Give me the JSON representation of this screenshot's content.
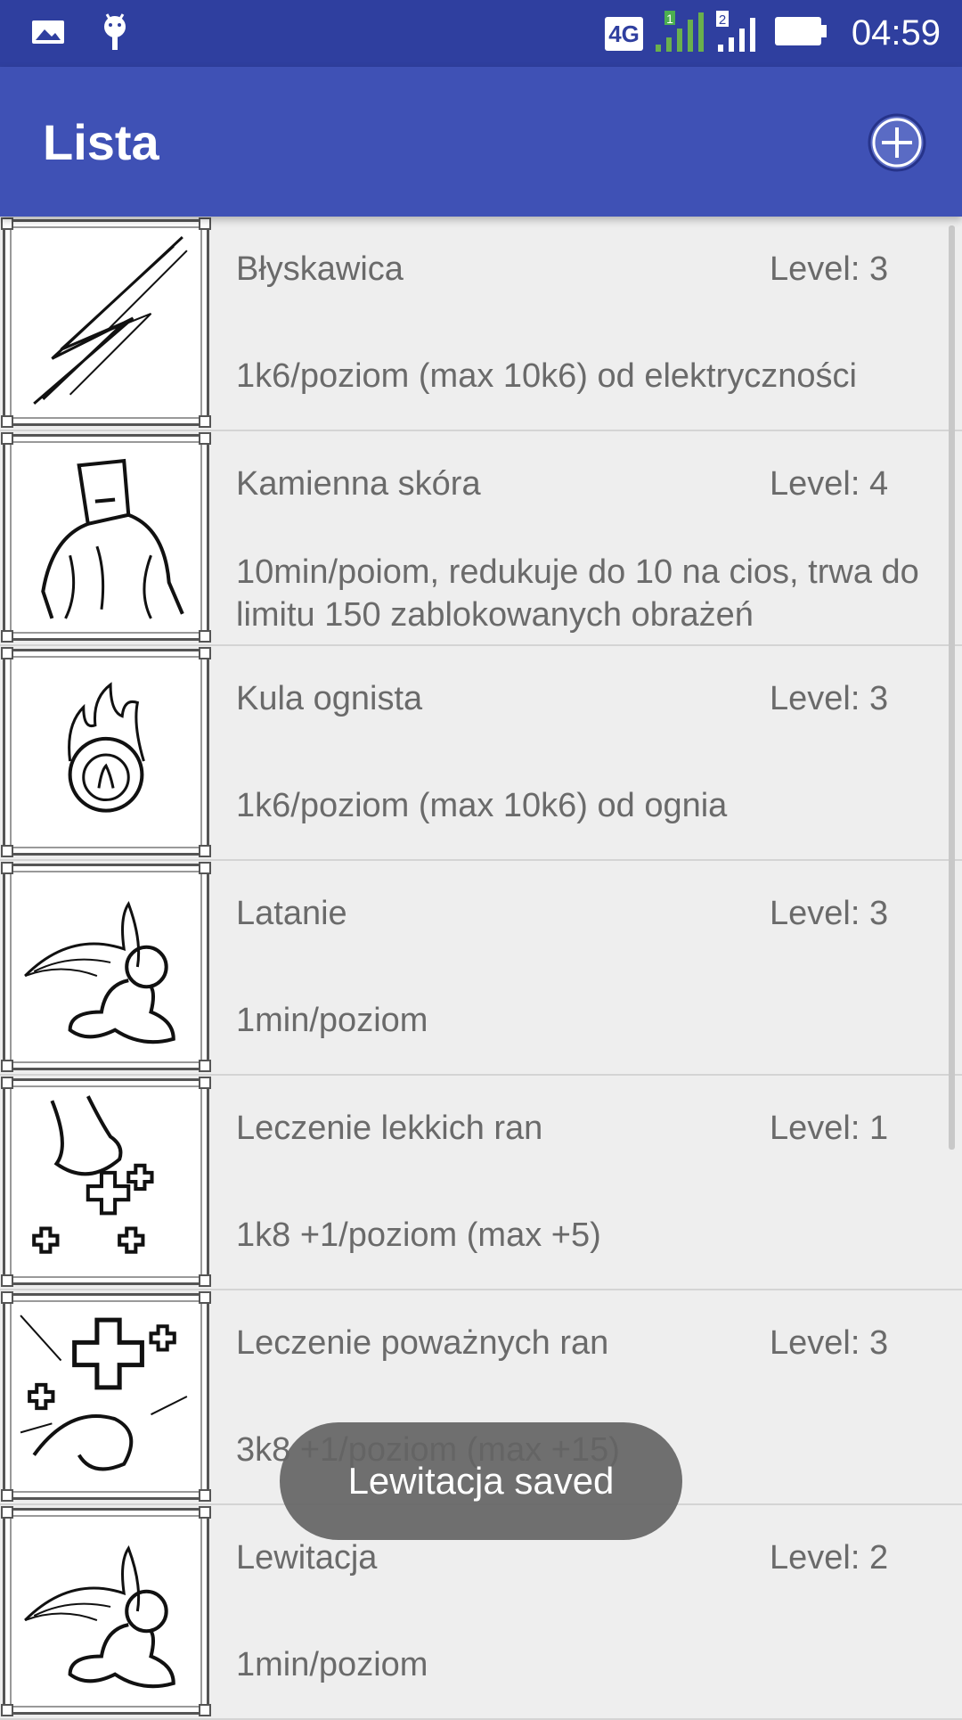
{
  "status_bar": {
    "time": "04:59",
    "network": "4G",
    "sim1": "1",
    "sim2": "2",
    "icons": [
      "gallery-icon",
      "android-icon",
      "signal-icon",
      "battery-icon"
    ]
  },
  "app_bar": {
    "title": "Lista",
    "add_icon": "add-circle-icon"
  },
  "spells": [
    {
      "name": "Błyskawica",
      "level": "Level: 3",
      "desc": "1k6/poziom (max 10k6) od elektryczności",
      "image": "lightning-icon"
    },
    {
      "name": "Kamienna skóra",
      "level": "Level: 4",
      "desc": "10min/poiom, redukuje do 10 na cios, trwa do limitu 150 zablokowanych obrażeń",
      "image": "stone-skin-icon"
    },
    {
      "name": "Kula ognista",
      "level": "Level: 3",
      "desc": "1k6/poziom (max 10k6) od ognia",
      "image": "fireball-icon"
    },
    {
      "name": "Latanie",
      "level": "Level: 3",
      "desc": "1min/poziom",
      "image": "winged-figure-icon"
    },
    {
      "name": "Leczenie lekkich ran",
      "level": "Level: 1",
      "desc": "1k8 +1/poziom (max +5)",
      "image": "healing-hand-icon"
    },
    {
      "name": "Leczenie poważnych ran",
      "level": "Level: 3",
      "desc": "3k8 +1/poziom (max +15)",
      "image": "healing-cross-icon"
    },
    {
      "name": "Lewitacja",
      "level": "Level: 2",
      "desc": "1min/poziom",
      "image": "winged-figure-icon"
    }
  ],
  "toast": {
    "message": "Lewitacja saved"
  }
}
